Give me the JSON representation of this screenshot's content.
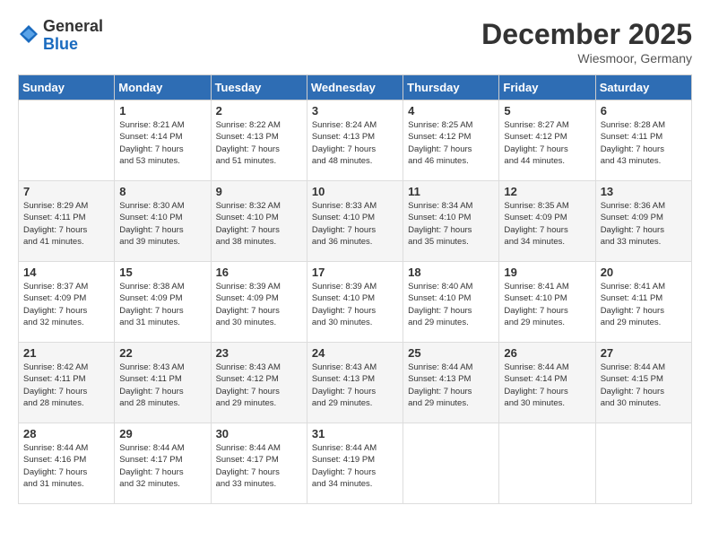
{
  "logo": {
    "general": "General",
    "blue": "Blue"
  },
  "title": "December 2025",
  "location": "Wiesmoor, Germany",
  "days_of_week": [
    "Sunday",
    "Monday",
    "Tuesday",
    "Wednesday",
    "Thursday",
    "Friday",
    "Saturday"
  ],
  "weeks": [
    [
      {
        "day": "",
        "info": ""
      },
      {
        "day": "1",
        "info": "Sunrise: 8:21 AM\nSunset: 4:14 PM\nDaylight: 7 hours\nand 53 minutes."
      },
      {
        "day": "2",
        "info": "Sunrise: 8:22 AM\nSunset: 4:13 PM\nDaylight: 7 hours\nand 51 minutes."
      },
      {
        "day": "3",
        "info": "Sunrise: 8:24 AM\nSunset: 4:13 PM\nDaylight: 7 hours\nand 48 minutes."
      },
      {
        "day": "4",
        "info": "Sunrise: 8:25 AM\nSunset: 4:12 PM\nDaylight: 7 hours\nand 46 minutes."
      },
      {
        "day": "5",
        "info": "Sunrise: 8:27 AM\nSunset: 4:12 PM\nDaylight: 7 hours\nand 44 minutes."
      },
      {
        "day": "6",
        "info": "Sunrise: 8:28 AM\nSunset: 4:11 PM\nDaylight: 7 hours\nand 43 minutes."
      }
    ],
    [
      {
        "day": "7",
        "info": "Sunrise: 8:29 AM\nSunset: 4:11 PM\nDaylight: 7 hours\nand 41 minutes."
      },
      {
        "day": "8",
        "info": "Sunrise: 8:30 AM\nSunset: 4:10 PM\nDaylight: 7 hours\nand 39 minutes."
      },
      {
        "day": "9",
        "info": "Sunrise: 8:32 AM\nSunset: 4:10 PM\nDaylight: 7 hours\nand 38 minutes."
      },
      {
        "day": "10",
        "info": "Sunrise: 8:33 AM\nSunset: 4:10 PM\nDaylight: 7 hours\nand 36 minutes."
      },
      {
        "day": "11",
        "info": "Sunrise: 8:34 AM\nSunset: 4:10 PM\nDaylight: 7 hours\nand 35 minutes."
      },
      {
        "day": "12",
        "info": "Sunrise: 8:35 AM\nSunset: 4:09 PM\nDaylight: 7 hours\nand 34 minutes."
      },
      {
        "day": "13",
        "info": "Sunrise: 8:36 AM\nSunset: 4:09 PM\nDaylight: 7 hours\nand 33 minutes."
      }
    ],
    [
      {
        "day": "14",
        "info": "Sunrise: 8:37 AM\nSunset: 4:09 PM\nDaylight: 7 hours\nand 32 minutes."
      },
      {
        "day": "15",
        "info": "Sunrise: 8:38 AM\nSunset: 4:09 PM\nDaylight: 7 hours\nand 31 minutes."
      },
      {
        "day": "16",
        "info": "Sunrise: 8:39 AM\nSunset: 4:09 PM\nDaylight: 7 hours\nand 30 minutes."
      },
      {
        "day": "17",
        "info": "Sunrise: 8:39 AM\nSunset: 4:10 PM\nDaylight: 7 hours\nand 30 minutes."
      },
      {
        "day": "18",
        "info": "Sunrise: 8:40 AM\nSunset: 4:10 PM\nDaylight: 7 hours\nand 29 minutes."
      },
      {
        "day": "19",
        "info": "Sunrise: 8:41 AM\nSunset: 4:10 PM\nDaylight: 7 hours\nand 29 minutes."
      },
      {
        "day": "20",
        "info": "Sunrise: 8:41 AM\nSunset: 4:11 PM\nDaylight: 7 hours\nand 29 minutes."
      }
    ],
    [
      {
        "day": "21",
        "info": "Sunrise: 8:42 AM\nSunset: 4:11 PM\nDaylight: 7 hours\nand 28 minutes."
      },
      {
        "day": "22",
        "info": "Sunrise: 8:43 AM\nSunset: 4:11 PM\nDaylight: 7 hours\nand 28 minutes."
      },
      {
        "day": "23",
        "info": "Sunrise: 8:43 AM\nSunset: 4:12 PM\nDaylight: 7 hours\nand 29 minutes."
      },
      {
        "day": "24",
        "info": "Sunrise: 8:43 AM\nSunset: 4:13 PM\nDaylight: 7 hours\nand 29 minutes."
      },
      {
        "day": "25",
        "info": "Sunrise: 8:44 AM\nSunset: 4:13 PM\nDaylight: 7 hours\nand 29 minutes."
      },
      {
        "day": "26",
        "info": "Sunrise: 8:44 AM\nSunset: 4:14 PM\nDaylight: 7 hours\nand 30 minutes."
      },
      {
        "day": "27",
        "info": "Sunrise: 8:44 AM\nSunset: 4:15 PM\nDaylight: 7 hours\nand 30 minutes."
      }
    ],
    [
      {
        "day": "28",
        "info": "Sunrise: 8:44 AM\nSunset: 4:16 PM\nDaylight: 7 hours\nand 31 minutes."
      },
      {
        "day": "29",
        "info": "Sunrise: 8:44 AM\nSunset: 4:17 PM\nDaylight: 7 hours\nand 32 minutes."
      },
      {
        "day": "30",
        "info": "Sunrise: 8:44 AM\nSunset: 4:17 PM\nDaylight: 7 hours\nand 33 minutes."
      },
      {
        "day": "31",
        "info": "Sunrise: 8:44 AM\nSunset: 4:19 PM\nDaylight: 7 hours\nand 34 minutes."
      },
      {
        "day": "",
        "info": ""
      },
      {
        "day": "",
        "info": ""
      },
      {
        "day": "",
        "info": ""
      }
    ]
  ]
}
